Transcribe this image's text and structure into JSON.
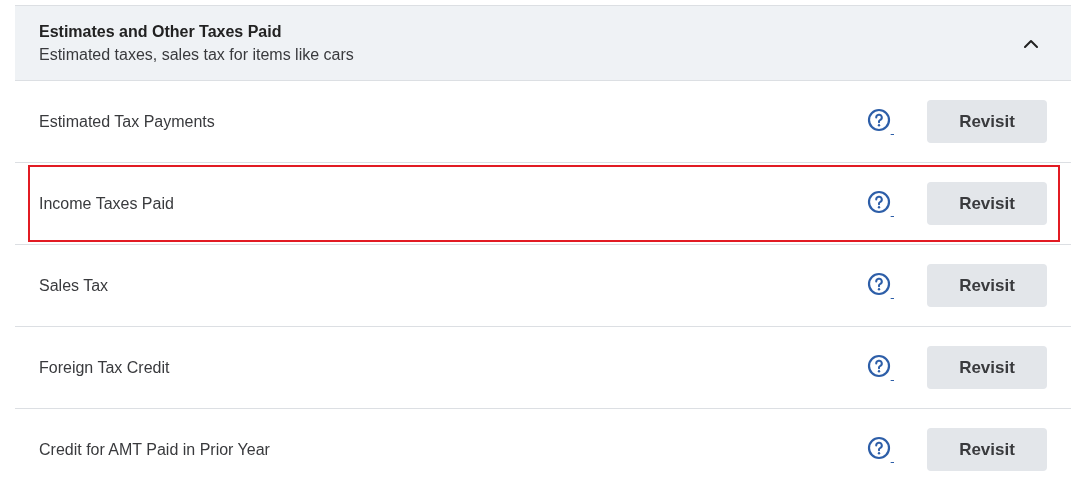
{
  "section": {
    "title": "Estimates and Other Taxes Paid",
    "subtitle": "Estimated taxes, sales tax for items like cars",
    "expanded": true
  },
  "rows": [
    {
      "label": "Estimated Tax Payments",
      "button": "Revisit",
      "highlighted": false
    },
    {
      "label": "Income Taxes Paid",
      "button": "Revisit",
      "highlighted": true
    },
    {
      "label": "Sales Tax",
      "button": "Revisit",
      "highlighted": false
    },
    {
      "label": "Foreign Tax Credit",
      "button": "Revisit",
      "highlighted": false
    },
    {
      "label": "Credit for AMT Paid in Prior Year",
      "button": "Revisit",
      "highlighted": false
    }
  ]
}
